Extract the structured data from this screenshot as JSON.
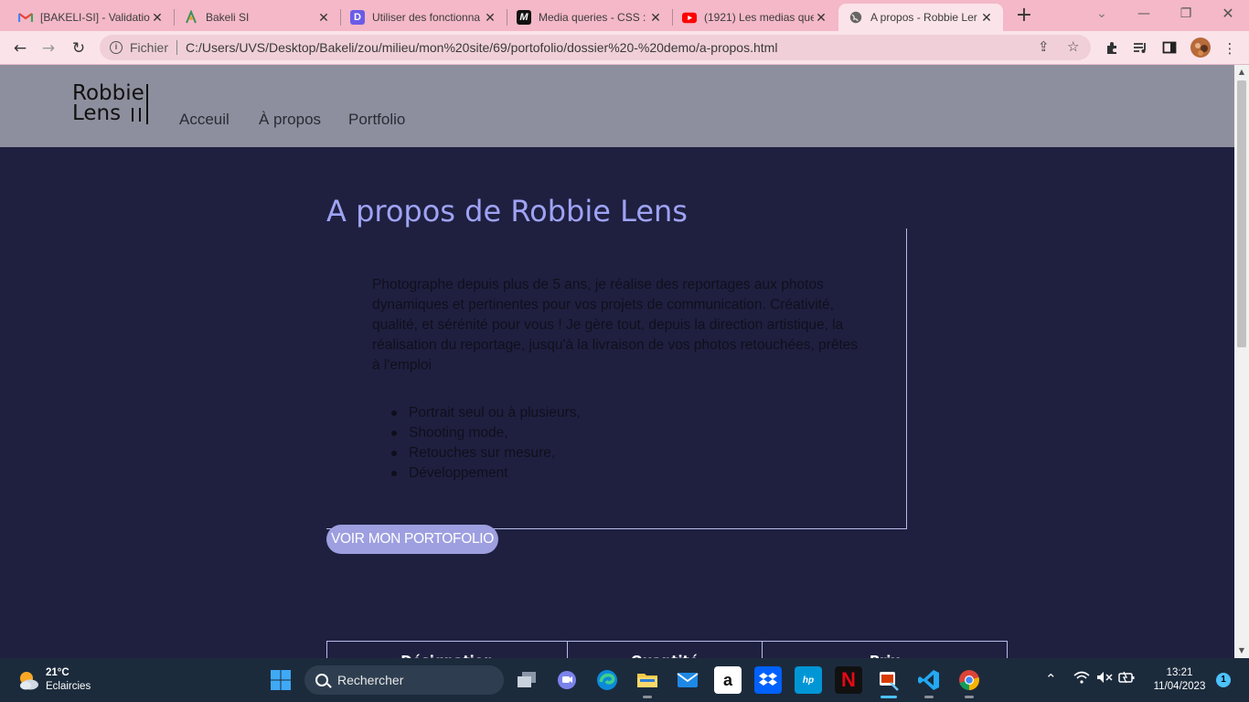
{
  "browser": {
    "tabs": [
      {
        "title": "[BAKELI-SI] - Validatio",
        "icon": "gmail-icon"
      },
      {
        "title": "Bakeli SI",
        "icon": "bakeli-icon"
      },
      {
        "title": "Utiliser des fonctionna",
        "icon": "notion-purple-icon"
      },
      {
        "title": "Media queries - CSS :",
        "icon": "mdn-icon"
      },
      {
        "title": "(1921) Les medias que",
        "icon": "youtube-icon"
      },
      {
        "title": "A propos - Robbie Ler",
        "icon": "globe-icon",
        "active": true
      }
    ],
    "address": {
      "scheme_label": "Fichier",
      "url": "C:/Users/UVS/Desktop/Bakeli/zou/milieu/mon%20site/69/portofolio/dossier%20-%20demo/a-propos.html"
    }
  },
  "site": {
    "logo_line1": "Robbie",
    "logo_line2": "Lens",
    "nav": [
      "Acceuil",
      "À propos",
      "Portfolio"
    ],
    "title": "A propos de Robbie Lens",
    "about": "Photographe depuis plus de 5 ans, je réalise des reportages aux photos dynamiques et pertinentes pour vos projets de communication. Créativité, qualité, et sérénité pour vous ! Je gère tout, depuis la direction artistique, la réalisation du reportage, jusqu'à la livraison de vos photos retouchées, prêtes à l'emploi",
    "skills": [
      "Portrait seul ou à plusieurs,",
      "Shooting mode,",
      "Retouches sur mesure,",
      "Développement"
    ],
    "cta": "VOIR MON PORTOFOLIO",
    "table_headers": [
      "Désignation",
      "Quantité",
      "Prix"
    ]
  },
  "taskbar": {
    "weather_temp": "21°C",
    "weather_desc": "Eclaircies",
    "search_placeholder": "Rechercher",
    "time": "13:21",
    "date": "11/04/2023",
    "notifications": "1"
  }
}
